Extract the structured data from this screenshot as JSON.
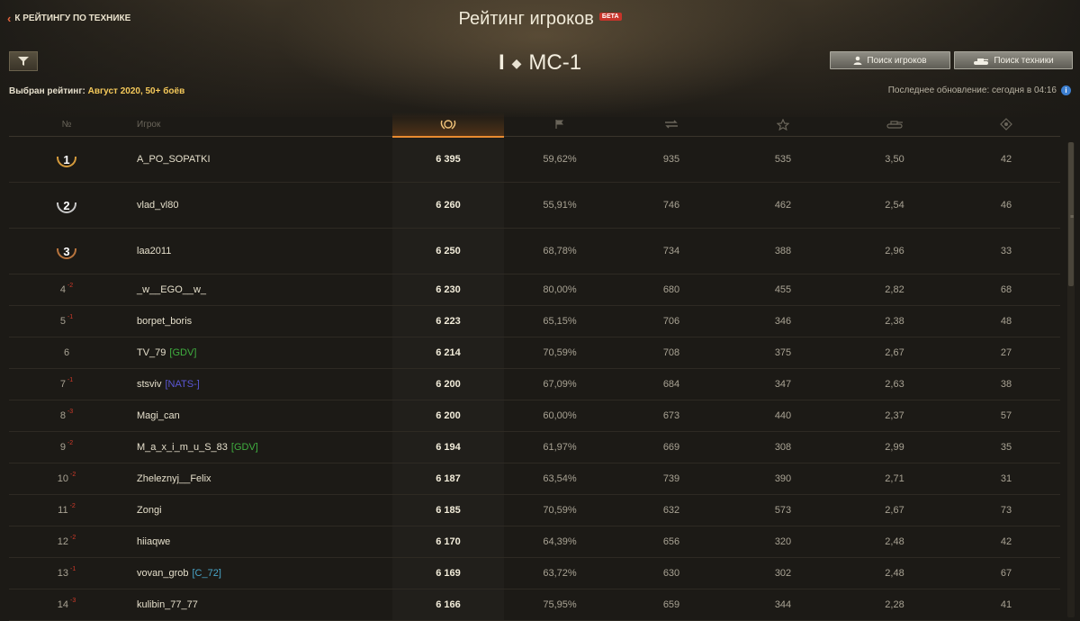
{
  "header": {
    "back_link": "К РЕЙТИНГУ ПО ТЕХНИКЕ",
    "title": "Рейтинг игроков",
    "beta_badge": "БЕТА",
    "vehicle_tier": "I",
    "vehicle_name": "МС-1",
    "selected_label": "Выбран рейтинг:",
    "selected_value": "Август 2020, 50+ боёв",
    "search_players_label": "Поиск игроков",
    "search_tech_label": "Поиск техники",
    "updated_text": "Последнее обновление: сегодня в 04:16",
    "info_icon_label": "i"
  },
  "columns": {
    "rank": "№",
    "player": "Игрок"
  },
  "colors": {
    "accent": "#e98a2e",
    "delta": "#d13a2a",
    "clan_green": "#3fae3f",
    "clan_blue": "#5b57d6",
    "clan_teal": "#49a6c9",
    "gold": "#d49a3c",
    "silver": "#c8c8c8",
    "bronze": "#b8743d"
  },
  "rows": [
    {
      "rank": "1",
      "medal": "gold",
      "delta": "",
      "name": "A_PO_SOPATKI",
      "clan": "",
      "clan_color": "",
      "score": "6 395",
      "c3": "59,62%",
      "c4": "935",
      "c5": "535",
      "c6": "3,50",
      "c7": "42"
    },
    {
      "rank": "2",
      "medal": "silver",
      "delta": "",
      "name": "vlad_vl80",
      "clan": "",
      "clan_color": "",
      "score": "6 260",
      "c3": "55,91%",
      "c4": "746",
      "c5": "462",
      "c6": "2,54",
      "c7": "46"
    },
    {
      "rank": "3",
      "medal": "bronze",
      "delta": "",
      "name": "laa2011",
      "clan": "",
      "clan_color": "",
      "score": "6 250",
      "c3": "68,78%",
      "c4": "734",
      "c5": "388",
      "c6": "2,96",
      "c7": "33"
    },
    {
      "rank": "4",
      "medal": "",
      "delta": "-2",
      "name": "_w__EGO__w_",
      "clan": "",
      "clan_color": "",
      "score": "6 230",
      "c3": "80,00%",
      "c4": "680",
      "c5": "455",
      "c6": "2,82",
      "c7": "68"
    },
    {
      "rank": "5",
      "medal": "",
      "delta": "-1",
      "name": "borpet_boris",
      "clan": "",
      "clan_color": "",
      "score": "6 223",
      "c3": "65,15%",
      "c4": "706",
      "c5": "346",
      "c6": "2,38",
      "c7": "48"
    },
    {
      "rank": "6",
      "medal": "",
      "delta": "",
      "name": "TV_79",
      "clan": "[GDV]",
      "clan_color": "#3fae3f",
      "score": "6 214",
      "c3": "70,59%",
      "c4": "708",
      "c5": "375",
      "c6": "2,67",
      "c7": "27"
    },
    {
      "rank": "7",
      "medal": "",
      "delta": "-1",
      "name": "stsviv",
      "clan": "[NATS-]",
      "clan_color": "#5b57d6",
      "score": "6 200",
      "c3": "67,09%",
      "c4": "684",
      "c5": "347",
      "c6": "2,63",
      "c7": "38"
    },
    {
      "rank": "8",
      "medal": "",
      "delta": "-3",
      "name": "Magi_can",
      "clan": "",
      "clan_color": "",
      "score": "6 200",
      "c3": "60,00%",
      "c4": "673",
      "c5": "440",
      "c6": "2,37",
      "c7": "57"
    },
    {
      "rank": "9",
      "medal": "",
      "delta": "-2",
      "name": "M_a_x_i_m_u_S_83",
      "clan": "[GDV]",
      "clan_color": "#3fae3f",
      "score": "6 194",
      "c3": "61,97%",
      "c4": "669",
      "c5": "308",
      "c6": "2,99",
      "c7": "35"
    },
    {
      "rank": "10",
      "medal": "",
      "delta": "-2",
      "name": "Zheleznyj__Felix",
      "clan": "",
      "clan_color": "",
      "score": "6 187",
      "c3": "63,54%",
      "c4": "739",
      "c5": "390",
      "c6": "2,71",
      "c7": "31"
    },
    {
      "rank": "11",
      "medal": "",
      "delta": "-2",
      "name": "Zongi",
      "clan": "",
      "clan_color": "",
      "score": "6 185",
      "c3": "70,59%",
      "c4": "632",
      "c5": "573",
      "c6": "2,67",
      "c7": "73"
    },
    {
      "rank": "12",
      "medal": "",
      "delta": "-2",
      "name": "hiiaqwe",
      "clan": "",
      "clan_color": "",
      "score": "6 170",
      "c3": "64,39%",
      "c4": "656",
      "c5": "320",
      "c6": "2,48",
      "c7": "42"
    },
    {
      "rank": "13",
      "medal": "",
      "delta": "-1",
      "name": "vovan_grob",
      "clan": "[C_72]",
      "clan_color": "#49a6c9",
      "score": "6 169",
      "c3": "63,72%",
      "c4": "630",
      "c5": "302",
      "c6": "2,48",
      "c7": "67"
    },
    {
      "rank": "14",
      "medal": "",
      "delta": "-3",
      "name": "kulibin_77_77",
      "clan": "",
      "clan_color": "",
      "score": "6 166",
      "c3": "75,95%",
      "c4": "659",
      "c5": "344",
      "c6": "2,28",
      "c7": "41"
    }
  ]
}
